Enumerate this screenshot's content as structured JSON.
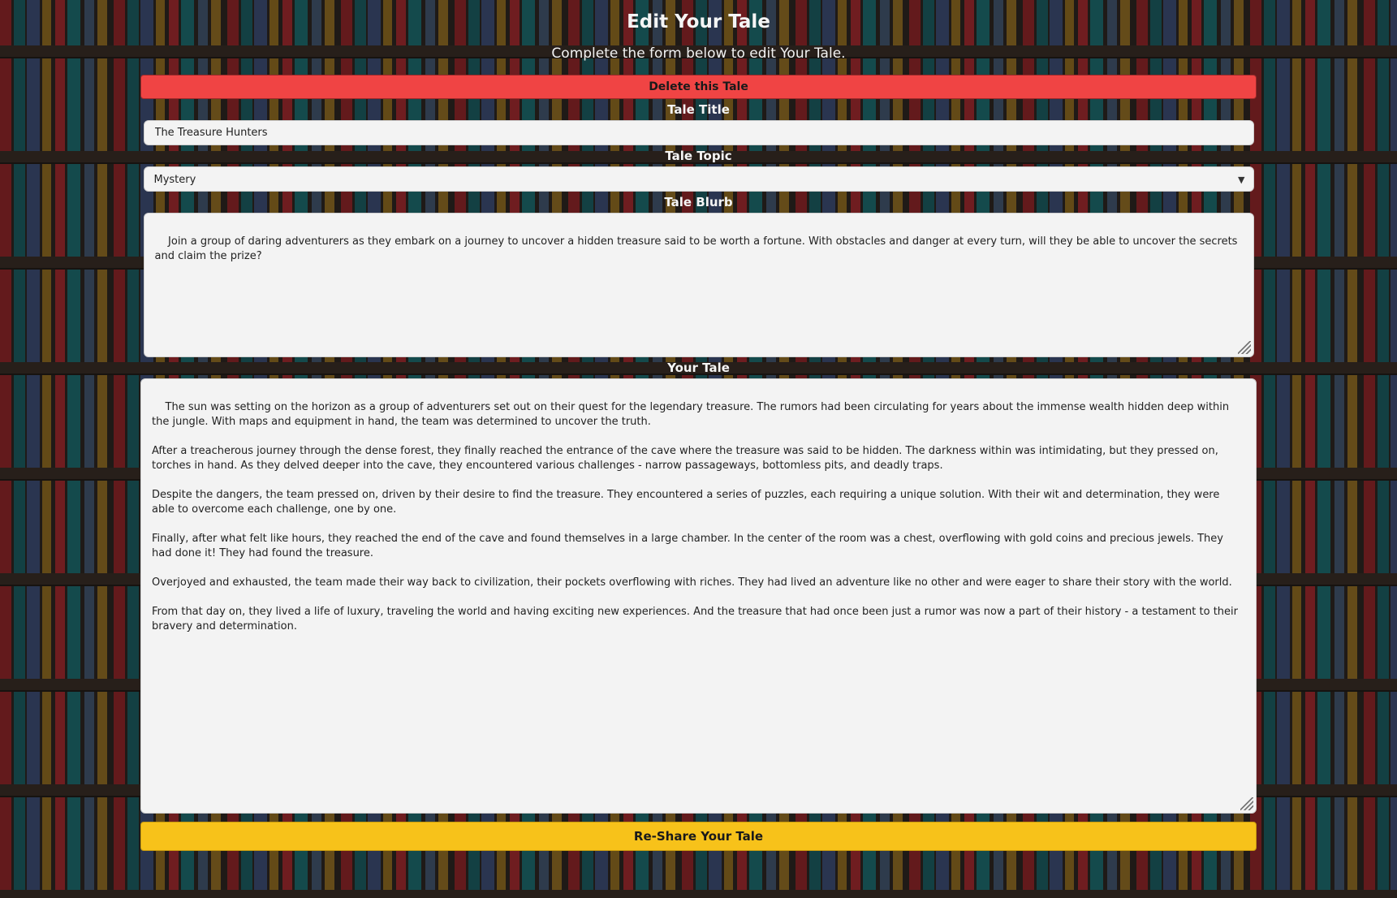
{
  "page": {
    "title": "Edit Your Tale",
    "subtitle": "Complete the form below to edit Your Tale."
  },
  "actions": {
    "delete_label": "Delete this Tale",
    "submit_label": "Re-Share Your Tale"
  },
  "form": {
    "title_label": "Tale Title",
    "title_value": "The Treasure Hunters",
    "topic_label": "Tale Topic",
    "topic_value": "Mystery",
    "blurb_label": "Tale Blurb",
    "blurb_value": "Join a group of daring adventurers as they embark on a journey to uncover a hidden treasure said to be worth a fortune. With obstacles and danger at every turn, will they be able to uncover the secrets and claim the prize?",
    "story_label": "Your Tale",
    "story_value": "The sun was setting on the horizon as a group of adventurers set out on their quest for the legendary treasure. The rumors had been circulating for years about the immense wealth hidden deep within the jungle. With maps and equipment in hand, the team was determined to uncover the truth.\n\nAfter a treacherous journey through the dense forest, they finally reached the entrance of the cave where the treasure was said to be hidden. The darkness within was intimidating, but they pressed on, torches in hand. As they delved deeper into the cave, they encountered various challenges - narrow passageways, bottomless pits, and deadly traps.\n\nDespite the dangers, the team pressed on, driven by their desire to find the treasure. They encountered a series of puzzles, each requiring a unique solution. With their wit and determination, they were able to overcome each challenge, one by one.\n\nFinally, after what felt like hours, they reached the end of the cave and found themselves in a large chamber. In the center of the room was a chest, overflowing with gold coins and precious jewels. They had done it! They had found the treasure.\n\nOverjoyed and exhausted, the team made their way back to civilization, their pockets overflowing with riches. They had lived an adventure like no other and were eager to share their story with the world.\n\nFrom that day on, they lived a life of luxury, traveling the world and having exciting new experiences. And the treasure that had once been just a rumor was now a part of their history - a testament to their bravery and determination."
  },
  "colors": {
    "delete": "#f04444",
    "submit": "#f7c21a",
    "field_bg": "#f3f3f3"
  },
  "icons": {
    "select": "chevron-down-icon",
    "resize": "resize-grip-icon"
  }
}
